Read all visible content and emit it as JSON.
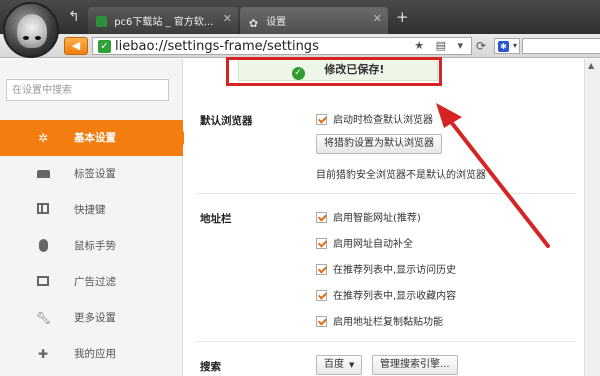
{
  "browser": {
    "back_icon": "back-arrow-icon",
    "tabs": [
      {
        "title": "pc6下载站 _ 官方软...",
        "close": "✕"
      },
      {
        "title": "设置",
        "close": "✕"
      }
    ],
    "new_tab": "+",
    "address": {
      "url": "liebao://settings-frame/settings",
      "icons": "★ ▤ ▾"
    }
  },
  "sidebar": {
    "search_placeholder": "在设置中搜索",
    "items": [
      {
        "label": "基本设置",
        "icon": "gear-icon",
        "active": true
      },
      {
        "label": "标签设置",
        "icon": "tab-icon",
        "active": false
      },
      {
        "label": "快捷键",
        "icon": "keyboard-icon",
        "active": false
      },
      {
        "label": "鼠标手势",
        "icon": "mouse-icon",
        "active": false
      },
      {
        "label": "广告过滤",
        "icon": "filter-icon",
        "active": false
      },
      {
        "label": "更多设置",
        "icon": "wrench-icon",
        "active": false
      },
      {
        "label": "我的应用",
        "icon": "puzzle-icon",
        "active": false
      }
    ]
  },
  "main": {
    "saved_message": "修改已保存!",
    "default_browser": {
      "title": "默认浏览器",
      "check_label": "启动时检查默认浏览器",
      "set_button": "将猎豹设置为默认浏览器",
      "status": "目前猎豹安全浏览器不是默认的浏览器"
    },
    "address_bar": {
      "title": "地址栏",
      "options": [
        "启用智能网址(推荐)",
        "启用网址自动补全",
        "在推荐列表中,显示访问历史",
        "在推荐列表中,显示收藏内容",
        "启用地址栏复制黏贴功能"
      ]
    },
    "search": {
      "title": "搜索",
      "engine": "百度",
      "manage_button": "管理搜索引擎..."
    }
  },
  "colors": {
    "accent": "#f47d0f",
    "annotation": "#d62323",
    "success": "#2f9e2f"
  }
}
